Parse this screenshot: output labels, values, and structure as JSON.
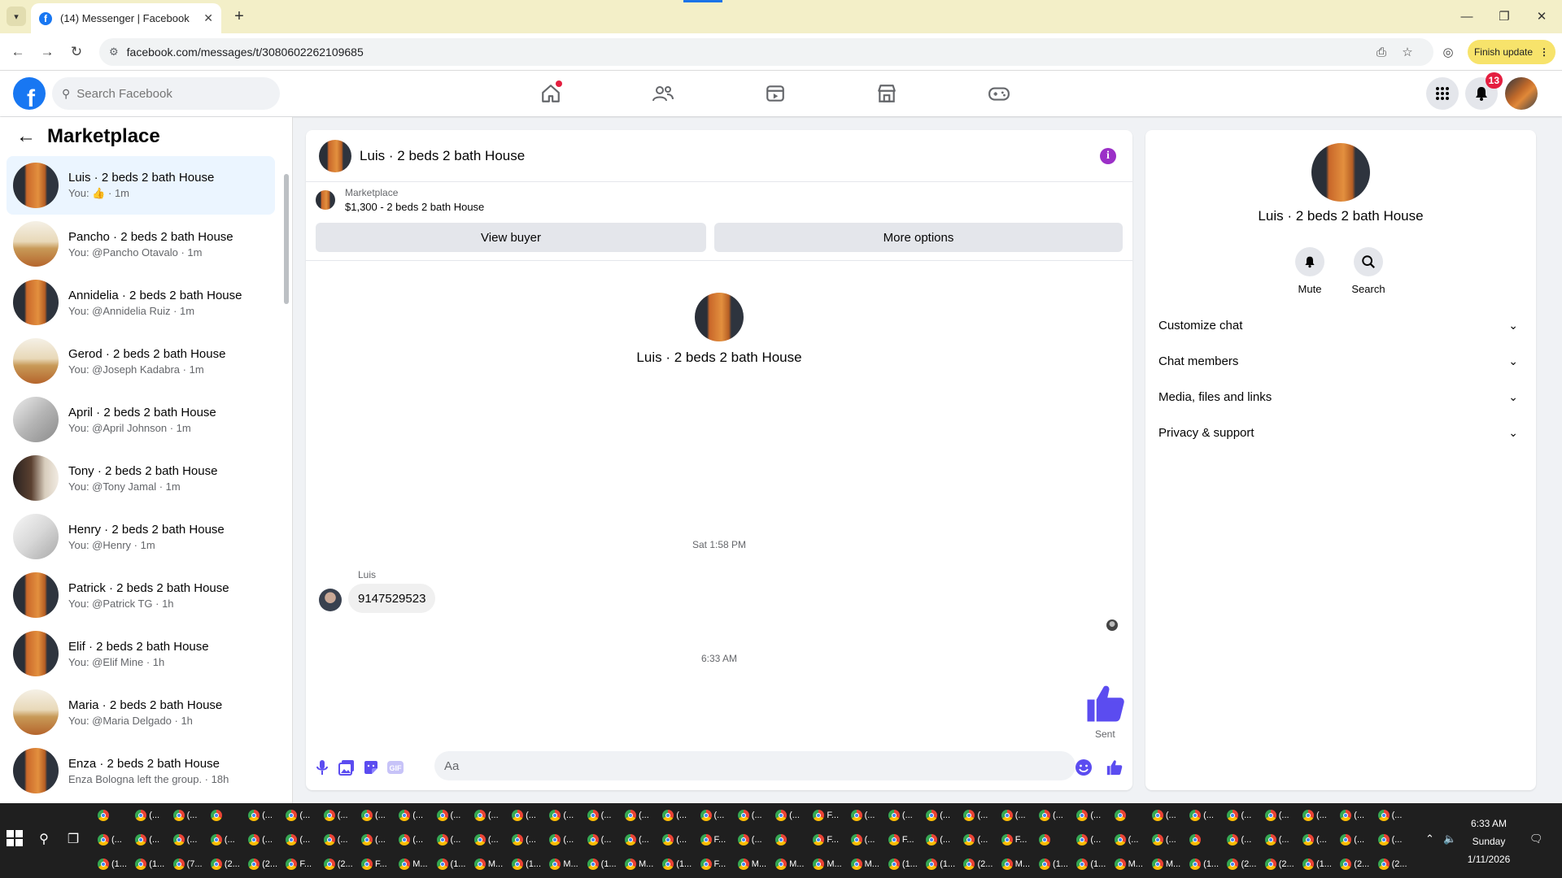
{
  "browser": {
    "tab_title": "(14) Messenger | Facebook",
    "url": "facebook.com/messages/t/3080602262109685",
    "finish_update_label": "Finish update"
  },
  "fb": {
    "search_placeholder": "Search Facebook",
    "notification_count": "13",
    "accent_color": "#1877f2",
    "messenger_color": "#5b4cf0"
  },
  "sidebar": {
    "title": "Marketplace",
    "conversations": [
      {
        "title": "Luis · 2 beds 2 bath House",
        "sub_prefix": "You:",
        "sub": "· 1m",
        "avatar": "door"
      },
      {
        "title": "Pancho · 2 beds 2 bath House",
        "sub": "You: @Pancho Otavalo · 1m",
        "avatar": "room"
      },
      {
        "title": "Annidelia · 2 beds 2 bath House",
        "sub": "You: @Annidelia Ruiz · 1m",
        "avatar": "door"
      },
      {
        "title": "Gerod · 2 beds 2 bath House",
        "sub": "You: @Joseph Kadabra · 1m",
        "avatar": "room"
      },
      {
        "title": "April · 2 beds 2 bath House",
        "sub": "You: @April Johnson · 1m",
        "avatar": "grey"
      },
      {
        "title": "Tony · 2 beds 2 bath House",
        "sub": "You: @Tony Jamal · 1m",
        "avatar": "dark"
      },
      {
        "title": "Henry · 2 beds 2 bath House",
        "sub": "You: @Henry · 1m",
        "avatar": "white"
      },
      {
        "title": "Patrick · 2 beds 2 bath House",
        "sub": "You: @Patrick TG · 1h",
        "avatar": "door"
      },
      {
        "title": "Elif · 2 beds 2 bath House",
        "sub": "You: @Elif Mine · 1h",
        "avatar": "door"
      },
      {
        "title": "Maria · 2 beds 2 bath House",
        "sub": "You: @Maria Delgado · 1h",
        "avatar": "room"
      },
      {
        "title": "Enza · 2 beds 2 bath House",
        "sub": "Enza Bologna left the group. · 18h",
        "avatar": "door"
      }
    ]
  },
  "chat": {
    "title": "Luis · 2 beds 2 bath House",
    "marketplace_label": "Marketplace",
    "listing": "$1,300 - 2 beds 2 bath House",
    "view_buyer_label": "View buyer",
    "more_options_label": "More options",
    "profile_name": "Luis · 2 beds 2 bath House",
    "time_1": "Sat 1:58 PM",
    "sender": "Luis",
    "message": "9147529523",
    "time_2": "6:33 AM",
    "sent_label": "Sent",
    "composer_placeholder": "Aa"
  },
  "details": {
    "name": "Luis · 2 beds 2 bath House",
    "mute_label": "Mute",
    "search_label": "Search",
    "sections": [
      "Customize chat",
      "Chat members",
      "Media, files and links",
      "Privacy & support"
    ]
  },
  "taskbar": {
    "time": "6:33 AM",
    "day": "Sunday",
    "date": "1/11/2026",
    "row1": [
      "",
      "(...",
      "(...",
      "",
      "(...",
      "(...",
      "(...",
      "(...",
      "(...",
      "(...",
      "(...",
      "(...",
      "(...",
      "(...",
      "(...",
      "(...",
      "(...",
      "(...",
      "(...",
      "F...",
      "(...",
      "(...",
      "(...",
      "(...",
      "(...",
      "(...",
      "(...",
      "",
      "(...",
      "(...",
      "(...",
      "(...",
      "(...",
      "(...",
      "(..."
    ],
    "row2": [
      "(...",
      "(...",
      "(...",
      "(...",
      "(...",
      "(...",
      "(...",
      "(...",
      "(...",
      "(...",
      "(...",
      "(...",
      "(...",
      "(...",
      "(...",
      "(...",
      "F...",
      "(...",
      "",
      "F...",
      "(...",
      "F...",
      "(...",
      "(...",
      "F...",
      "",
      "(...",
      "(...",
      "(...",
      "",
      "(...",
      "(...",
      "(...",
      "(...",
      "(..."
    ],
    "row3": [
      "(1...",
      "(1...",
      "(7...",
      "(2...",
      "(2...",
      "F...",
      "(2...",
      "F...",
      "M...",
      "(1...",
      "M...",
      "(1...",
      "M...",
      "(1...",
      "M...",
      "(1...",
      "F...",
      "M...",
      "M...",
      "M...",
      "M...",
      "(1...",
      "(1...",
      "(2...",
      "M...",
      "(1...",
      "(1...",
      "M...",
      "M...",
      "(1...",
      "(2...",
      "(2...",
      "(1...",
      "(2...",
      "(2..."
    ]
  }
}
